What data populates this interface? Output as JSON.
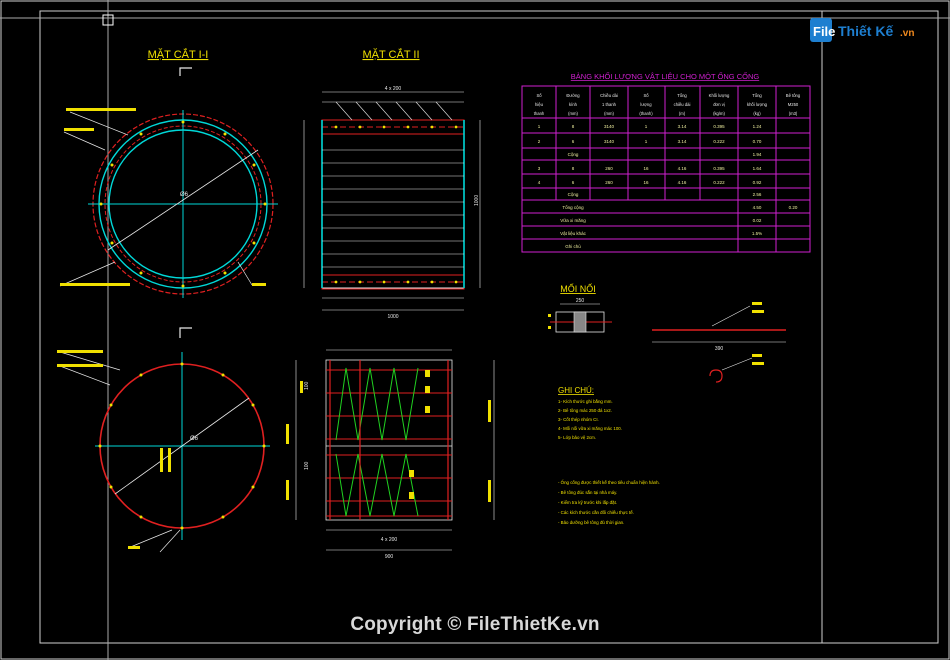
{
  "titles": {
    "section_1_1": "MẶT CẮT I-I",
    "section_2_2": "MẶT CẮT II",
    "table_title": "BẢNG KHỐI LƯỢNG VẬT LIỆU CHO MỘT ỐNG CỐNG",
    "joint": "MỐI NỐI",
    "notes": "GHI CHÚ:"
  },
  "labels": {
    "outer_dim": "1000",
    "height_dim": "1000",
    "pitch_a": "4 x 200",
    "pitch_b": "4 x 200",
    "bottom_dim": "900",
    "joint_dim": "250",
    "joint_bar": "390",
    "left_dim_1": "100",
    "left_dim_2": "100",
    "ring_1": "Ø6",
    "ring_2": "Ø6"
  },
  "table": {
    "header_row_1": [
      "Số",
      "Đường",
      "Chiều dài",
      "Số",
      "Tổng",
      "Khối lượng",
      "Tổng",
      "Bê tông"
    ],
    "header_row_2": [
      "hiệu",
      "kính",
      "1 thanh",
      "lượng",
      "chiều dài",
      "đơn vị",
      "khối lượng",
      "M250"
    ],
    "header_row_3": [
      "thanh",
      "(mm)",
      "(mm)",
      "(thanh)",
      "(m)",
      "(kg/m)",
      "(kg)",
      "(m3)"
    ],
    "rows": [
      [
        "1",
        "8",
        "3140",
        "1",
        "3.14",
        "0.395",
        "1.24",
        ""
      ],
      [
        "2",
        "6",
        "3140",
        "1",
        "3.14",
        "0.222",
        "0.70",
        ""
      ],
      [
        "",
        "Cộng",
        "",
        "",
        "",
        "",
        "1.94",
        ""
      ],
      [
        "3",
        "8",
        "260",
        "16",
        "4.16",
        "0.395",
        "1.64",
        ""
      ],
      [
        "4",
        "6",
        "260",
        "16",
        "4.16",
        "0.222",
        "0.92",
        ""
      ],
      [
        "",
        "Cộng",
        "",
        "",
        "",
        "",
        "2.56",
        ""
      ],
      [
        "",
        "Tổng cộng",
        "",
        "",
        "",
        "",
        "4.50",
        "0.20"
      ],
      [
        "",
        "Vữa xi măng",
        "",
        "",
        "",
        "",
        "0.02",
        ""
      ],
      [
        "",
        "Vật liệu khác",
        "",
        "",
        "",
        "",
        "1.5%",
        ""
      ],
      [
        "",
        "Ghi chú",
        "",
        "",
        "",
        "",
        "",
        ""
      ]
    ]
  },
  "notes": [
    "1- Kích thước ghi bằng mm.",
    "2- Bê tông mác 250 đá 1x2.",
    "3- Cốt thép nhóm CI.",
    "4- Mối nối vữa xi măng mác 100.",
    "5- Lớp bảo vệ 2cm.",
    "- Ống cống được thiết kế theo tiêu chuẩn hiện hành.",
    "- Bê tông đúc sẵn tại nhà máy.",
    "- Kiểm tra kỹ trước khi lắp đặt.",
    "- Các kích thước cần đối chiếu thực tế.",
    "- Bảo dưỡng bê tông đủ thời gian."
  ],
  "brand": {
    "logo_text_1": "File",
    "logo_text_2": "Thiết Kế",
    "logo_text_3": ".vn",
    "copyright": "Copyright © FileThietKe.vn"
  },
  "colors": {
    "background": "#000000",
    "frame": "#d0d0d0",
    "cyan": "#00d8d8",
    "red": "#e02020",
    "yellow": "#f0e000",
    "magenta": "#d020d0",
    "green": "#20d020",
    "white": "#e8e8e8",
    "logo_blue": "#1e7fd0",
    "logo_orange": "#f28a1e"
  }
}
